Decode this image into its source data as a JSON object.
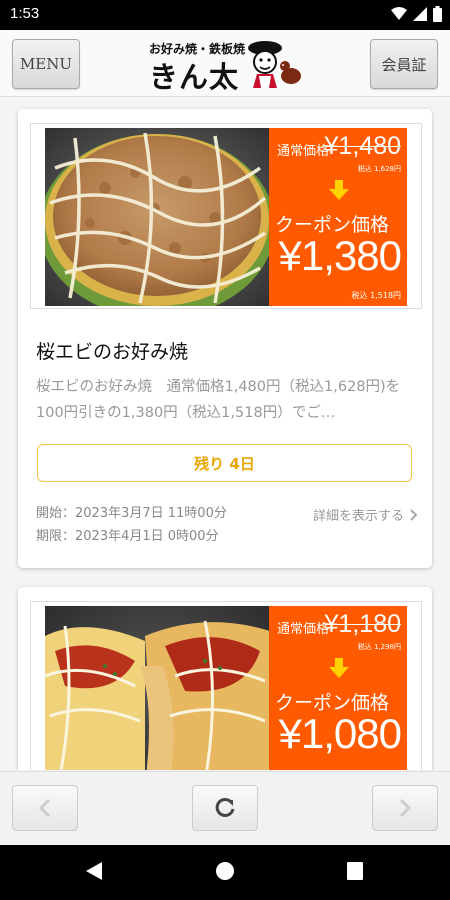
{
  "status_bar": {
    "time": "1:53"
  },
  "header": {
    "menu_label": "MENU",
    "member_label": "会員証",
    "logo_sub": "お好み焼・鉄板焼",
    "logo_main": "きん太"
  },
  "coupons": [
    {
      "normal_label": "通常価格",
      "normal_price": "¥1,480",
      "normal_tax": "税込 1,628円",
      "coupon_label": "クーポン価格",
      "coupon_price": "¥1,380",
      "coupon_tax": "税込 1,518円",
      "title": "桜エビのお好み焼",
      "description": "桜エビのお好み焼　通常価格1,480円（税込1,628円)を100円引きの1,380円（税込1,518円）でご…",
      "remaining": "残り 4日",
      "start": "開始：2023年3月7日 11時00分",
      "end": "期限：2023年4月1日 0時00分",
      "detail_link": "詳細を表示する"
    },
    {
      "normal_label": "通常価格",
      "normal_price": "¥1,180",
      "normal_tax": "税込 1,298円",
      "coupon_label": "クーポン価格",
      "coupon_price": "¥1,080"
    }
  ],
  "colors": {
    "price_panel": "#ff5a00",
    "arrow": "#ffd200",
    "remaining_accent": "#e8a600"
  },
  "icons": [
    "wifi-icon",
    "signal-icon",
    "battery-icon",
    "chevron-left-icon",
    "reload-icon",
    "chevron-right-icon",
    "nav-back-icon",
    "nav-home-icon",
    "nav-recents-icon"
  ]
}
